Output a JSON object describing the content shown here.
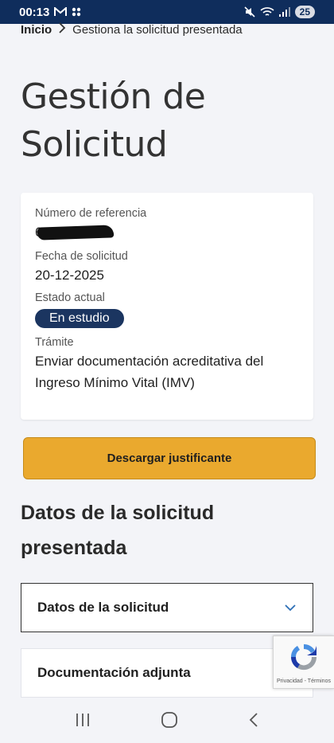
{
  "status_bar": {
    "time": "00:13",
    "battery": "25"
  },
  "breadcrumb": {
    "home": "Inicio",
    "current": "Gestiona la solicitud presentada"
  },
  "page_title": "Gestión de Solicitud",
  "card": {
    "reference_label": "Número de referencia",
    "reference_visible": "6",
    "date_label": "Fecha de solicitud",
    "date_value": "20-12-2025",
    "status_label": "Estado actual",
    "status_value": "En estudio",
    "procedure_label": "Trámite",
    "procedure_value": "Enviar documentación acreditativa del Ingreso Mínimo Vital (IMV)"
  },
  "download_button": "Descargar justificante",
  "section_heading": "Datos de la solicitud presentada",
  "accordions": [
    {
      "label": "Datos de la solicitud"
    },
    {
      "label": "Documentación adjunta"
    }
  ],
  "recaptcha": {
    "text": "Privacidad - Términos"
  },
  "colors": {
    "status_bar": "#0f2d5c",
    "accent_button": "#eaa92e",
    "badge": "#1b3560",
    "chevron": "#2d6fb6"
  }
}
